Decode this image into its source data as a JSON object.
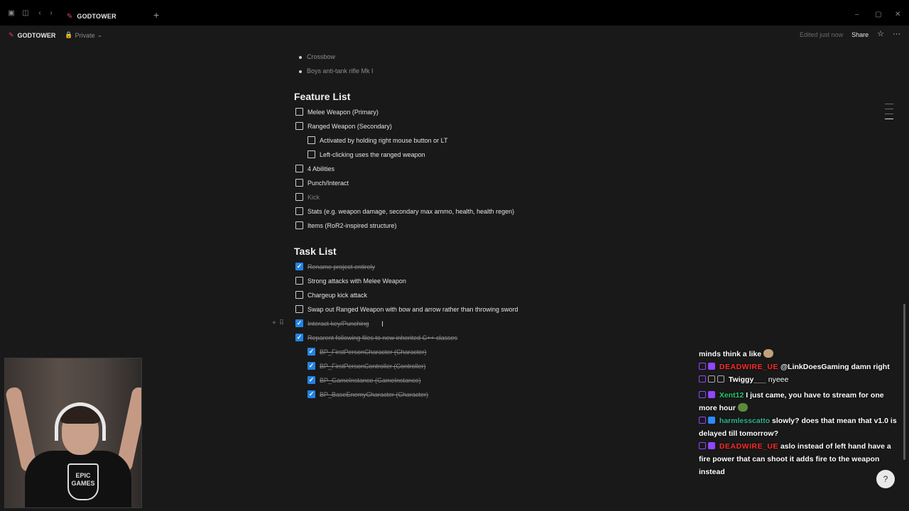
{
  "window": {
    "tab_title": "GODTOWER"
  },
  "header": {
    "title": "GODTOWER",
    "visibility": "Private",
    "edited": "Edited just now",
    "share": "Share"
  },
  "top_list": [
    "Crossbow",
    "Boys anti-tank rifle Mk I"
  ],
  "feature_list": {
    "heading": "Feature List",
    "items": [
      {
        "label": "Melee Weapon (Primary)",
        "checked": false,
        "indent": 0
      },
      {
        "label": "Ranged Weapon (Secondary)",
        "checked": false,
        "indent": 0
      },
      {
        "label": "Activated by holding right mouse button or LT",
        "checked": false,
        "indent": 1
      },
      {
        "label": "Left-clicking uses the ranged weapon",
        "checked": false,
        "indent": 1
      },
      {
        "label": "4 Abilities",
        "checked": false,
        "indent": 0
      },
      {
        "label": "Punch/Interact",
        "checked": false,
        "indent": 0
      },
      {
        "label": "Kick",
        "checked": false,
        "indent": 0,
        "muted": true
      },
      {
        "label": "Stats (e.g. weapon damage, secondary max ammo, health, health regen)",
        "checked": false,
        "indent": 0
      },
      {
        "label": "Items (RoR2-inspired structure)",
        "checked": false,
        "indent": 0
      }
    ]
  },
  "task_list": {
    "heading": "Task List",
    "items": [
      {
        "label": "Rename project entirely",
        "checked": true,
        "indent": 0
      },
      {
        "label": "Strong attacks with Melee Weapon",
        "checked": false,
        "indent": 0
      },
      {
        "label": "Chargeup kick attack",
        "checked": false,
        "indent": 0
      },
      {
        "label": "Swap out Ranged Weapon with bow and arrow rather than throwing sword",
        "checked": false,
        "indent": 0
      },
      {
        "label": "Interact key/Punching",
        "checked": true,
        "indent": 0
      },
      {
        "label": "Reparent following files to new inherited C++ classes",
        "checked": true,
        "indent": 0
      },
      {
        "label": "BP_FirstPersonCharacter (Character)",
        "checked": true,
        "indent": 1
      },
      {
        "label": "BP_FirstPersonController (Controller)",
        "checked": true,
        "indent": 1
      },
      {
        "label": "BP_GameInstance (GameInstance)",
        "checked": true,
        "indent": 1
      },
      {
        "label": "BP_BaseEnemyCharacter (Character)",
        "checked": true,
        "indent": 1
      }
    ]
  },
  "webcam": {
    "shirt_text_1": "EPIC",
    "shirt_text_2": "GAMES"
  },
  "chat": {
    "m0_text": "minds think a like",
    "m1_user": "DEADWIRE_UE",
    "m1_text": "@LinkDoesGaming damn right",
    "m2_user": "Twiggy___",
    "m2_text": "nyeee",
    "m3_user": "Xent12",
    "m3_text": "I just came, you have to stream for one more hour",
    "m4_user": "harmlesscatto",
    "m4_text": "slowly? does that mean that v1.0 is delayed till tomorrow?",
    "m5_user": "DEADWIRE_UE",
    "m5_text": "aslo instead of left hand have a fire power that can shoot it adds fire to the weapon instead"
  },
  "colors": {
    "accent": "#2383e2",
    "twitch": "#9146ff",
    "bg": "#191919"
  }
}
